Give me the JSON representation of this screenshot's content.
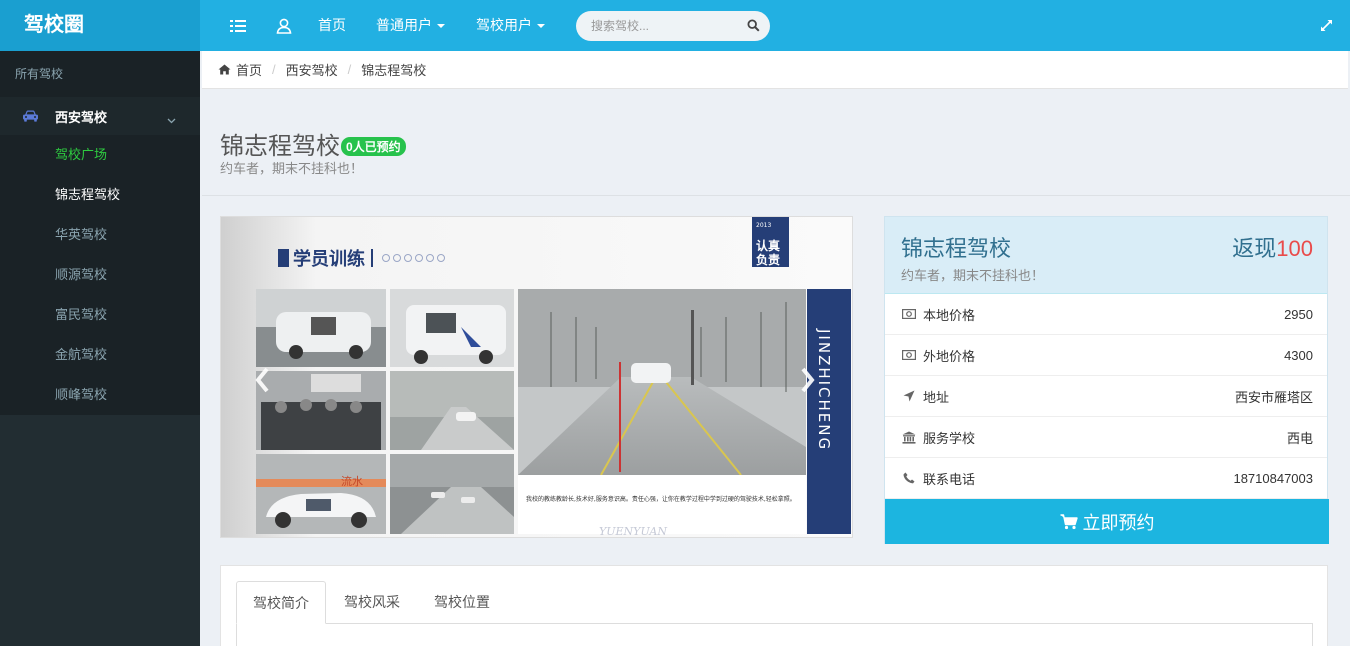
{
  "app": {
    "logo": "驾校圈"
  },
  "navbar": {
    "home": "首页",
    "regular_user": "普通用户",
    "school_user": "驾校用户",
    "search_placeholder": "搜索驾校..."
  },
  "sidebar": {
    "header": "所有驾校",
    "group": "西安驾校",
    "items": [
      "驾校广场",
      "锦志程驾校",
      "华英驾校",
      "顺源驾校",
      "富民驾校",
      "金航驾校",
      "顺峰驾校"
    ]
  },
  "breadcrumb": [
    "首页",
    "西安驾校",
    "锦志程驾校"
  ],
  "page": {
    "title": "锦志程驾校",
    "badge": "0人已预约",
    "subtitle": "约车者，期末不挂科也！"
  },
  "carousel": {
    "brochure_title": "学员训练",
    "stamp_text": [
      "认真",
      "负责"
    ],
    "stamp_year": "2013",
    "side_text": "JINZHICHENG",
    "banner_text": "流水",
    "caption": "我校的教练教龄长,技术好,服务意识高。责任心强，让你在教学过程中学到过硬的驾驶技术,轻松拿照。",
    "watermark": "YUENYUAN"
  },
  "info": {
    "name": "锦志程驾校",
    "cashback_label": "返现",
    "cashback_value": "100",
    "subtitle": "约车者，期末不挂科也！",
    "rows": [
      {
        "icon": "money-icon",
        "label": "本地价格",
        "value": "2950"
      },
      {
        "icon": "money-icon",
        "label": "外地价格",
        "value": "4300"
      },
      {
        "icon": "location-arrow-icon",
        "label": "地址",
        "value": "西安市雁塔区"
      },
      {
        "icon": "bank-icon",
        "label": "服务学校",
        "value": "西电"
      },
      {
        "icon": "phone-icon",
        "label": "联系电话",
        "value": "18710847003"
      }
    ],
    "book_button": "立即预约"
  },
  "tabs": [
    "驾校简介",
    "驾校风采",
    "驾校位置"
  ],
  "colors": {
    "logo_bg": "#1a9fd0",
    "navbar_bg": "#22b0e2",
    "sidebar_bg": "#222d32",
    "badge_green": "#27c24c",
    "cashback_red": "#e94b4b",
    "button_blue": "#1cb5e0"
  }
}
